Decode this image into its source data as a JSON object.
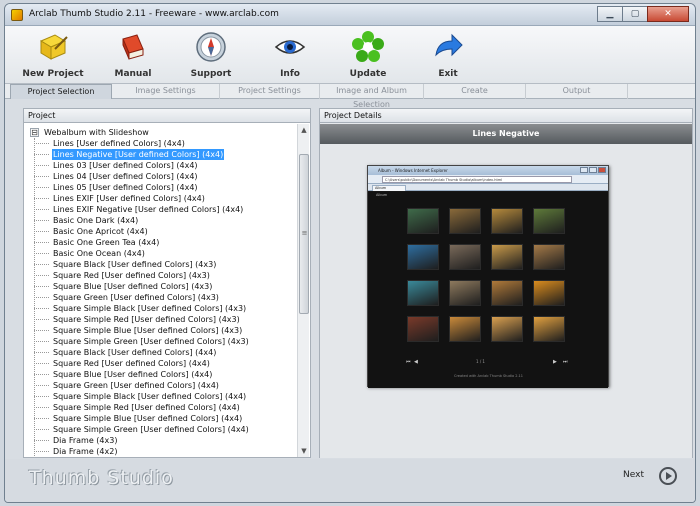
{
  "window": {
    "title": "Arclab Thumb Studio 2.11 - Freeware - www.arclab.com"
  },
  "toolbar": [
    {
      "label": "New Project",
      "icon": "new-project-icon"
    },
    {
      "label": "Manual",
      "icon": "manual-book-icon"
    },
    {
      "label": "Support",
      "icon": "support-compass-icon"
    },
    {
      "label": "Info",
      "icon": "info-eye-icon"
    },
    {
      "label": "Update",
      "icon": "update-flower-icon"
    },
    {
      "label": "Exit",
      "icon": "exit-arrow-icon"
    }
  ],
  "tabs": [
    {
      "label": "Project Selection",
      "active": true
    },
    {
      "label": "Image Settings",
      "active": false
    },
    {
      "label": "Project Settings",
      "active": false
    },
    {
      "label": "Image and Album Selection",
      "active": false
    },
    {
      "label": "Create",
      "active": false
    },
    {
      "label": "Output",
      "active": false
    }
  ],
  "project_panel": {
    "title": "Project",
    "root_expander": "⊟",
    "root": "Webalbum with Slideshow",
    "selected_index": 1,
    "items": [
      "Lines [User defined Colors] (4x4)",
      "Lines Negative [User defined Colors] (4x4)",
      "Lines 03 [User defined Colors] (4x4)",
      "Lines 04 [User defined Colors] (4x4)",
      "Lines 05 [User defined Colors] (4x4)",
      "Lines EXIF [User defined Colors] (4x4)",
      "Lines EXIF Negative [User defined Colors] (4x4)",
      "Basic One Dark (4x4)",
      "Basic One Apricot (4x4)",
      "Basic One Green Tea (4x4)",
      "Basic One Ocean (4x4)",
      "Square Black [User defined Colors] (4x3)",
      "Square Red [User defined Colors] (4x3)",
      "Square Blue [User defined Colors] (4x3)",
      "Square Green [User defined Colors] (4x3)",
      "Square Simple Black [User defined Colors] (4x3)",
      "Square Simple Red [User defined Colors] (4x3)",
      "Square Simple Blue [User defined Colors] (4x3)",
      "Square Simple Green [User defined Colors] (4x3)",
      "Square Black [User defined Colors] (4x4)",
      "Square Red [User defined Colors] (4x4)",
      "Square Blue [User defined Colors] (4x4)",
      "Square Green [User defined Colors] (4x4)",
      "Square Simple Black [User defined Colors] (4x4)",
      "Square Simple Red [User defined Colors] (4x4)",
      "Square Simple Blue [User defined Colors] (4x4)",
      "Square Simple Green [User defined Colors] (4x4)",
      "Dia Frame (4x3)",
      "Dia Frame (4x2)"
    ],
    "scroll_position": 0.0
  },
  "details_panel": {
    "title": "Project Details",
    "preview_title": "Lines Negative",
    "browser": {
      "title": "Album - Windows Internet Explorer",
      "url": "C:\\Users\\public\\Documents\\Arclab Thumb Studio\\album\\index.html",
      "tab": "Album",
      "gallery_label": "Album",
      "nav_first": "⏮",
      "nav_prev": "◀",
      "counter": "1 / 1",
      "nav_next": "▶",
      "nav_last": "⏭",
      "footer": "Created with Arclab Thumb Studio 2.11",
      "photo_colors": [
        [
          "#3f6b4a",
          "#8a6a3a",
          "#b58a3c",
          "#5e7a3a"
        ],
        [
          "#2e6ea0",
          "#7a6a5a",
          "#c89a4a",
          "#a47a48"
        ],
        [
          "#3a8a9a",
          "#8e7a5e",
          "#b07a3a",
          "#d98c1e"
        ],
        [
          "#7a3a2a",
          "#c98a3a",
          "#d9a050",
          "#e0a040"
        ]
      ]
    }
  },
  "footer": {
    "brand": "Thumb Studio",
    "next_label": "Next"
  },
  "colors": {
    "selection": "#3399ff",
    "preview_header": "#6b6f73",
    "window_bg": "#d8dde3"
  }
}
